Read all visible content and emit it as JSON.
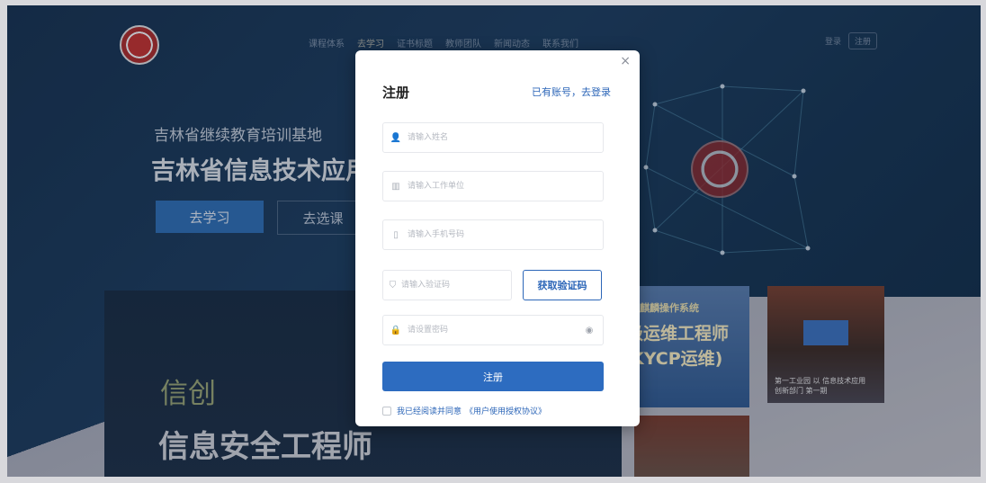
{
  "nav": {
    "items": [
      "课程体系",
      "去学习",
      "证书标题",
      "教师团队",
      "新闻动态",
      "联系我们"
    ],
    "active_index": 1,
    "login": "登录",
    "register": "注册"
  },
  "hero": {
    "subtitle": "吉林省继续教育培训基地",
    "title": "吉林省信息技术应用",
    "primary_button": "去学习",
    "secondary_button": "去选课"
  },
  "cards": {
    "dark_word1": "信创",
    "dark_word2": "信息安全工程师",
    "kylin_top": "麒麟操作系统",
    "kylin_line1": "级运维工程师",
    "kylin_line2": "KYCP运维)",
    "photo_caption_line1": "第一工业园 以 信息技术应用",
    "photo_caption_line2": "创新部门 第一期"
  },
  "modal": {
    "title": "注册",
    "login_hint": "已有账号，去登录",
    "close": "×",
    "fields": {
      "name_placeholder": "请输入姓名",
      "company_placeholder": "请输入工作单位",
      "phone_placeholder": "请输入手机号码",
      "code_placeholder": "请输入验证码",
      "password_placeholder": "请设置密码"
    },
    "get_code_button": "获取验证码",
    "submit_button": "注册",
    "agree_text": "我已经阅读并同意",
    "agree_link": "《用户使用授权协议》"
  },
  "colors": {
    "accent": "#2d6cc0",
    "background_dark": "#14304e"
  }
}
